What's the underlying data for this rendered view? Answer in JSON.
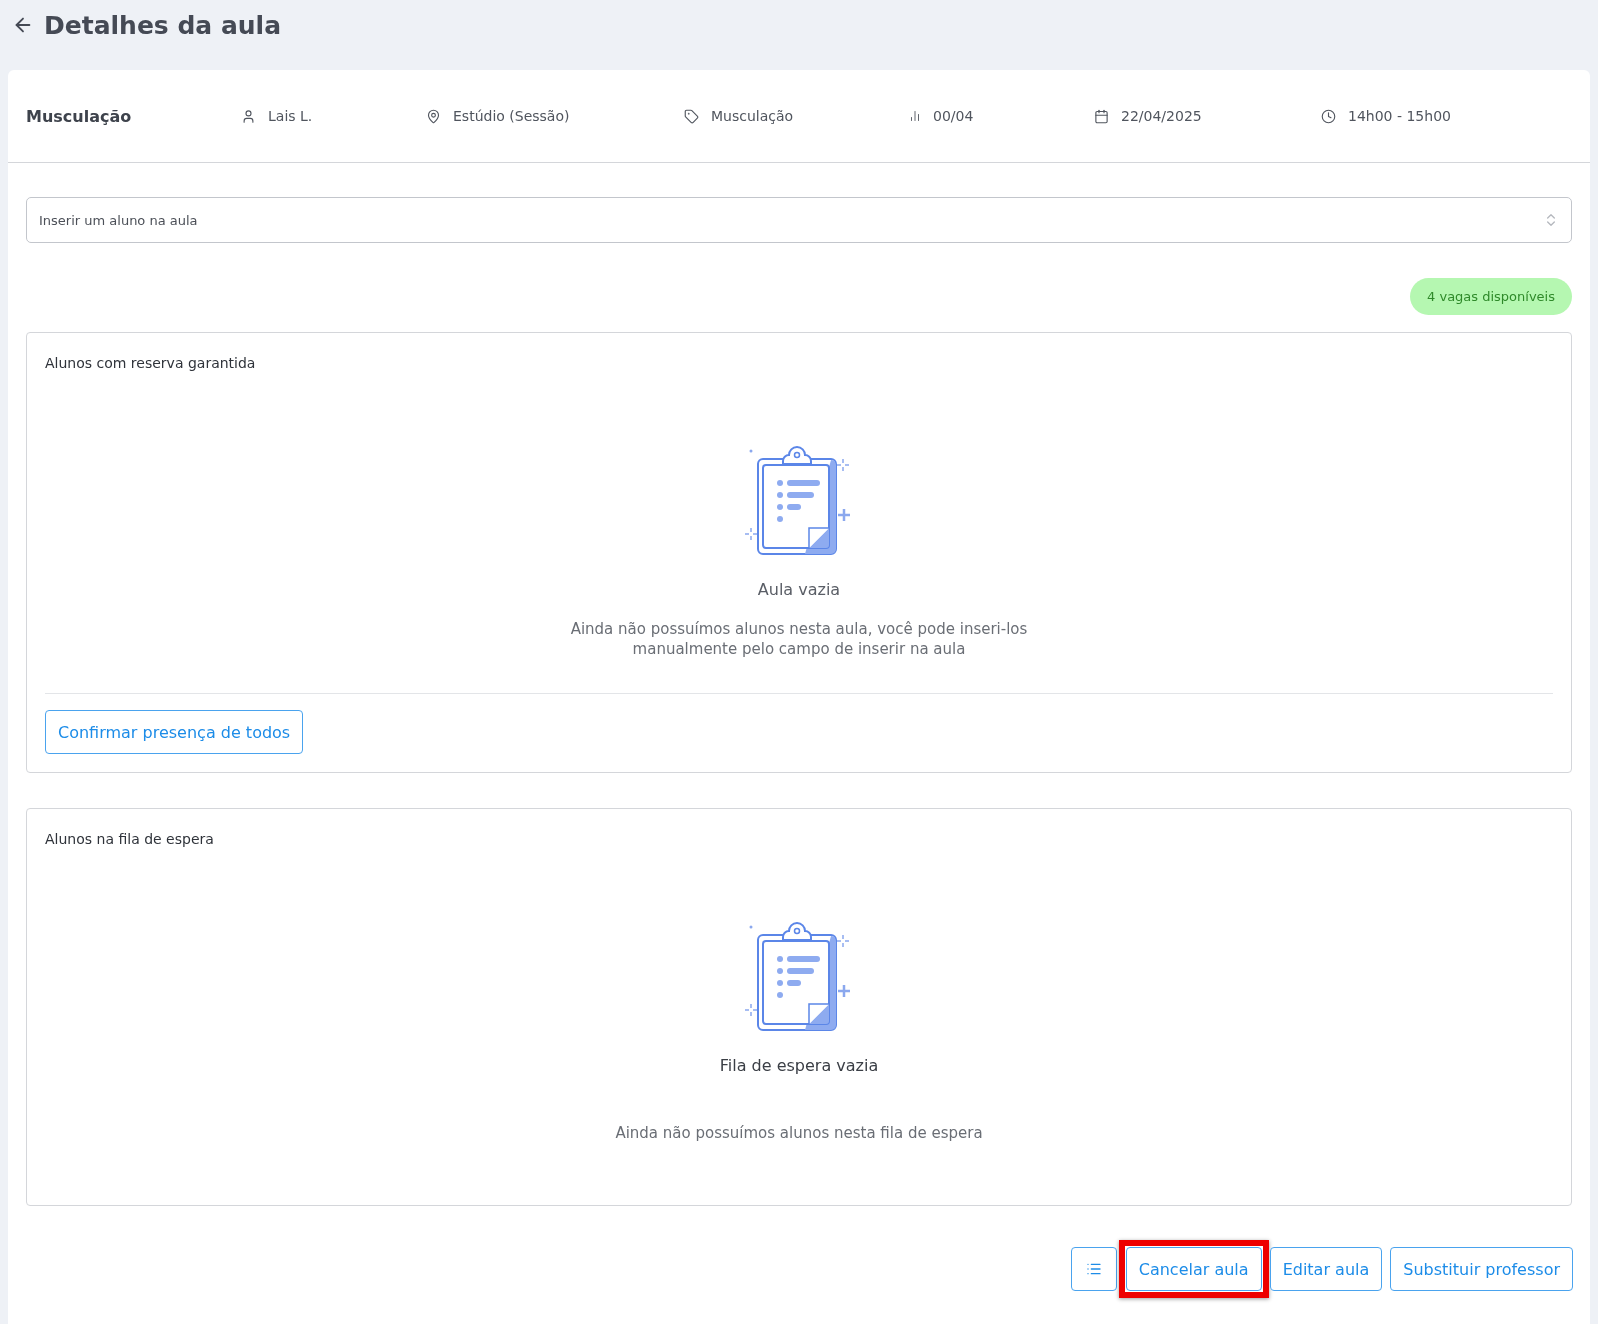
{
  "page": {
    "title": "Detalhes da aula"
  },
  "class_info": {
    "name": "Musculação",
    "details": [
      "Lais L.",
      "Estúdio (Sessão)",
      "Musculação",
      "00/04",
      "22/04/2025",
      "14h00 - 15h00"
    ]
  },
  "student_select": {
    "placeholder": "Inserir um aluno na aula"
  },
  "availability_badge": "4 vagas disponíveis",
  "panels": [
    {
      "title": "Alunos com reserva garantida",
      "empty_title": "Aula vazia",
      "empty_text": "Ainda não possuímos alunos nesta aula, você pode inseri-los manualmente pelo campo de inserir na aula",
      "action": "Confirmar presença de todos"
    },
    {
      "title": "Alunos na fila de espera",
      "empty_title": "Fila de espera vazia",
      "empty_text": "Ainda não possuímos alunos nesta fila de espera"
    }
  ],
  "footer_buttons": [
    {
      "label": "Cancelar aula",
      "highlighted": true
    },
    {
      "label": "Editar aula",
      "highlighted": false
    },
    {
      "label": "Substituir professor",
      "highlighted": false
    }
  ]
}
